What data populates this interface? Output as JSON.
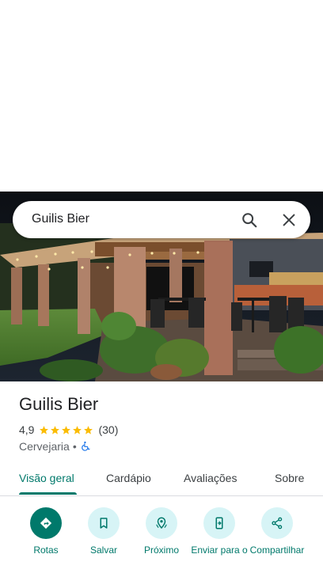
{
  "search": {
    "value": "Guilis Bier"
  },
  "place": {
    "name": "Guilis Bier",
    "rating": "4,9",
    "stars": 5,
    "reviews": "(30)",
    "category": "Cervejaria",
    "separator": "•",
    "accessibility_icon": "wheelchair-icon"
  },
  "tabs": [
    {
      "label": "Visão geral",
      "active": true
    },
    {
      "label": "Cardápio"
    },
    {
      "label": "Avaliações"
    },
    {
      "label": "Sobre"
    }
  ],
  "actions": [
    {
      "label": "Rotas",
      "icon": "directions-icon"
    },
    {
      "label": "Salvar",
      "icon": "bookmark-icon"
    },
    {
      "label": "Próximo",
      "icon": "nearby-icon"
    },
    {
      "label": "Enviar para o",
      "icon": "send-to-phone-icon"
    },
    {
      "label": "Compartilhar",
      "icon": "share-icon"
    }
  ],
  "colors": {
    "accent": "#00796b",
    "action_bg": "#d7f4f6",
    "star": "#fbbc04"
  }
}
